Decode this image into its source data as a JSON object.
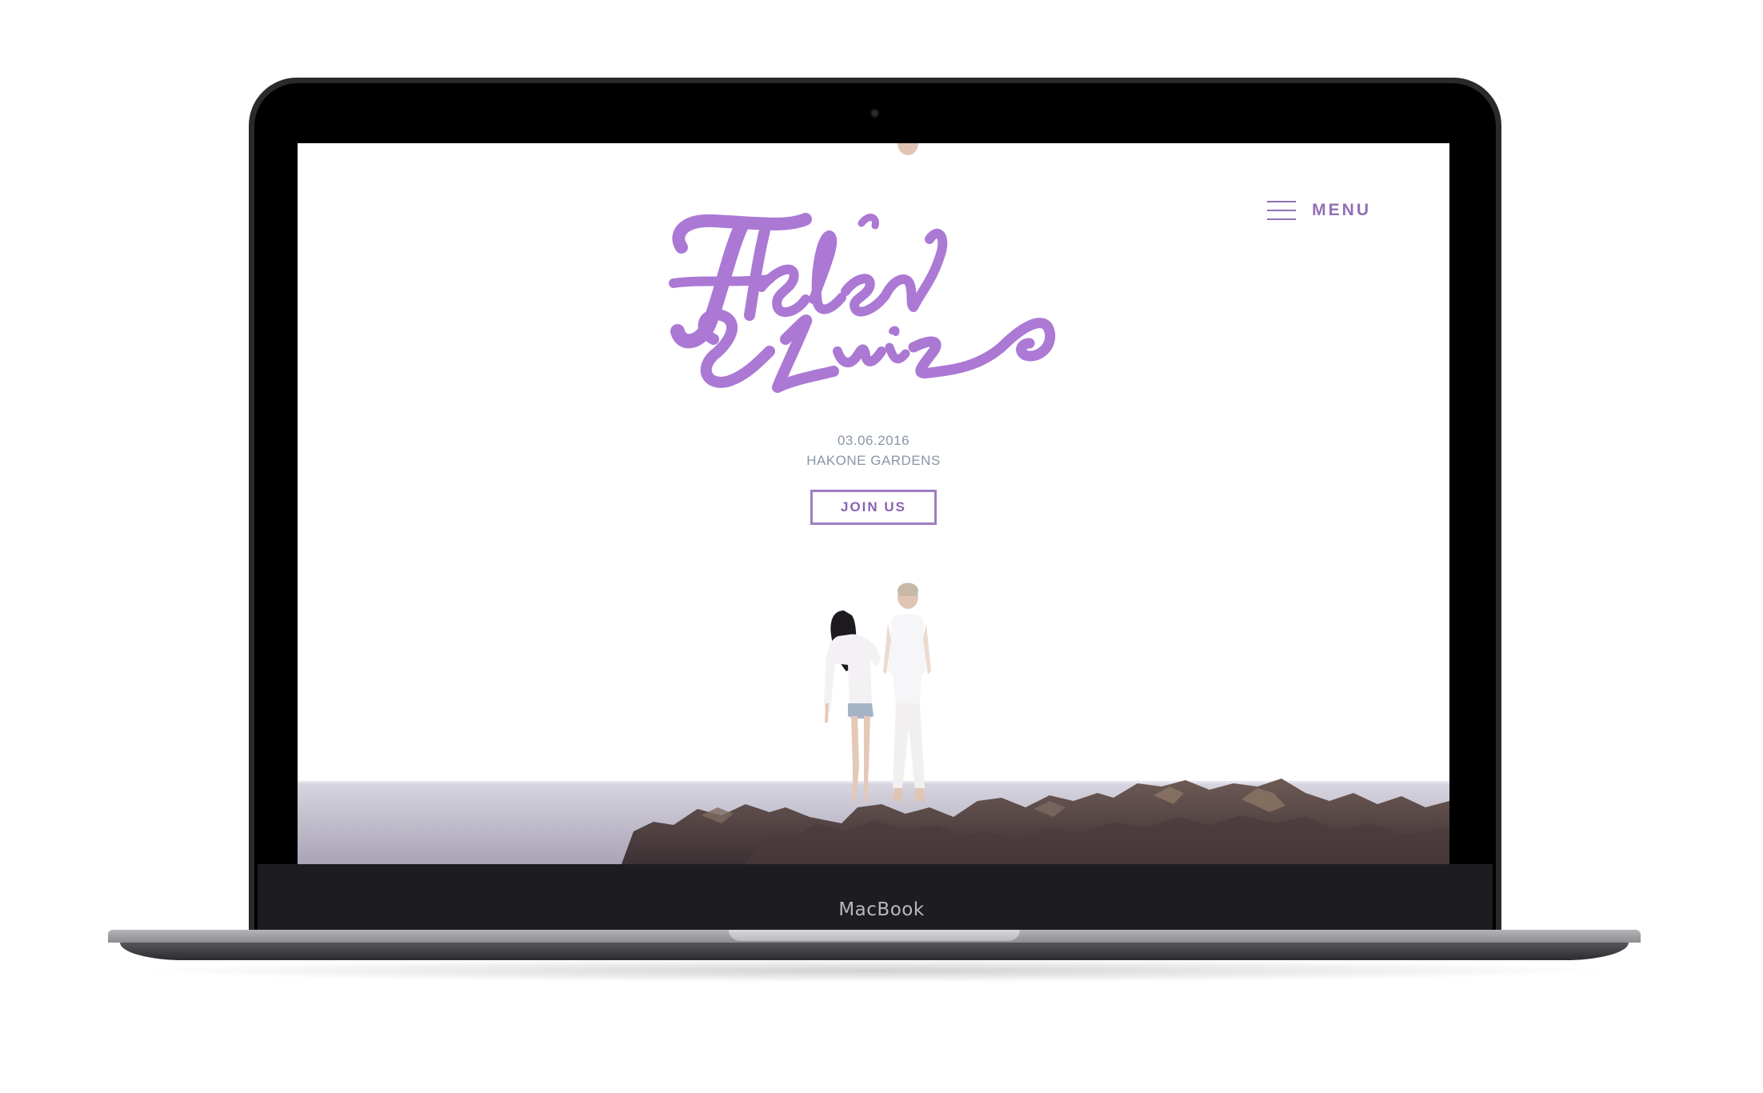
{
  "device": {
    "brand_label": "MacBook"
  },
  "site": {
    "menu_label": "MENU",
    "logo_lettering": "Helen & Luiz",
    "event": {
      "date": "03.06.2016",
      "venue": "HAKONE GARDENS"
    },
    "cta_label": "JOIN US"
  },
  "colors": {
    "accent": "#9270b6",
    "logo": "#a36ad0",
    "info_text": "#8a96a6"
  },
  "icons": {
    "menu": "hamburger-icon"
  }
}
